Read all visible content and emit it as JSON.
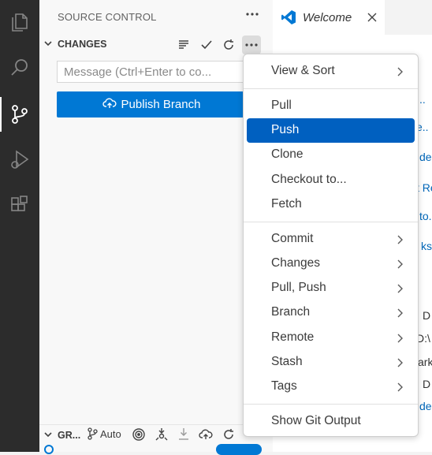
{
  "sidebar": {
    "title": "SOURCE CONTROL",
    "section": "CHANGES",
    "message_placeholder": "Message (Ctrl+Enter to co...",
    "publish_label": "Publish Branch",
    "graph": {
      "label": "GR...",
      "auto_label": "Auto"
    }
  },
  "tabs": [
    {
      "label": "Welcome"
    }
  ],
  "editor_fragments": [
    "..",
    "e..",
    "de",
    "t Re",
    "to..",
    "ks",
    "D",
    "D:\\",
    "ark",
    "D",
    "de"
  ],
  "menu": {
    "items": [
      {
        "label": "View & Sort",
        "submenu": true
      },
      {
        "label": "Pull",
        "submenu": false
      },
      {
        "label": "Push",
        "submenu": false,
        "selected": true
      },
      {
        "label": "Clone",
        "submenu": false
      },
      {
        "label": "Checkout to...",
        "submenu": false
      },
      {
        "label": "Fetch",
        "submenu": false
      },
      {
        "label": "Commit",
        "submenu": true
      },
      {
        "label": "Changes",
        "submenu": true
      },
      {
        "label": "Pull, Push",
        "submenu": true
      },
      {
        "label": "Branch",
        "submenu": true
      },
      {
        "label": "Remote",
        "submenu": true
      },
      {
        "label": "Stash",
        "submenu": true
      },
      {
        "label": "Tags",
        "submenu": true
      },
      {
        "label": "Show Git Output",
        "submenu": false
      }
    ]
  },
  "colors": {
    "accent": "#0078d4",
    "selection": "#0060c0",
    "activity_bar": "#2c2c2c"
  }
}
